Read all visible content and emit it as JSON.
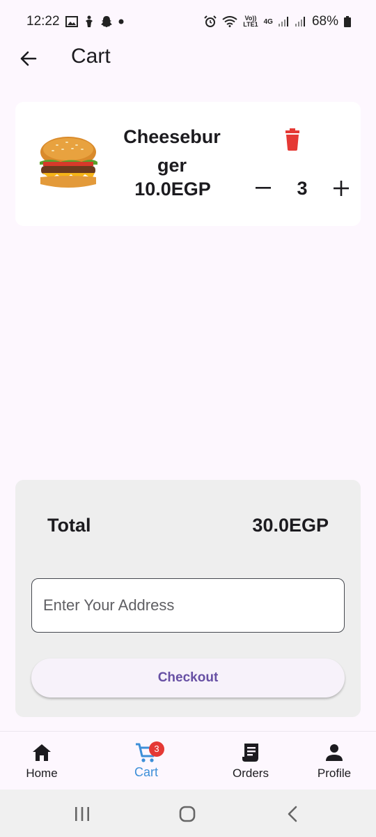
{
  "status_bar": {
    "time": "12:22",
    "battery": "68%",
    "network_labels": {
      "volte": "Vo))",
      "lte": "LTE1",
      "gen": "4G"
    },
    "icons": [
      "image-icon",
      "accessibility-icon",
      "snapchat-icon",
      "dot-icon",
      "alarm-icon",
      "wifi-icon",
      "signal-icon",
      "signal-icon",
      "battery-icon"
    ]
  },
  "app_bar": {
    "title": "Cart",
    "back_icon": "arrow-back-icon"
  },
  "cart_items": [
    {
      "name": "Cheeseburger",
      "price": "10.0EGP",
      "quantity": "3",
      "image": "burger-image",
      "delete_icon": "trash-icon",
      "delete_color": "#e53935"
    }
  ],
  "summary": {
    "total_label": "Total",
    "total_value": "30.0EGP",
    "address_placeholder": "Enter Your Address",
    "address_value": "",
    "checkout_label": "Checkout"
  },
  "bottom_nav": {
    "items": [
      {
        "label": "Home",
        "icon": "home-icon"
      },
      {
        "label": "Cart",
        "icon": "cart-icon",
        "badge": "3",
        "active": true
      },
      {
        "label": "Orders",
        "icon": "receipt-icon"
      },
      {
        "label": "Profile",
        "icon": "person-icon"
      }
    ],
    "active_color": "#3d8fd8"
  },
  "system_nav": {
    "icons": [
      "recent-apps-icon",
      "home-circle-icon",
      "back-chevron-icon"
    ]
  },
  "colors": {
    "background": "#fdf7fe",
    "card": "#ffffff",
    "summary_panel": "#eeeeee",
    "checkout_text": "#6750a4",
    "delete": "#e53935"
  }
}
